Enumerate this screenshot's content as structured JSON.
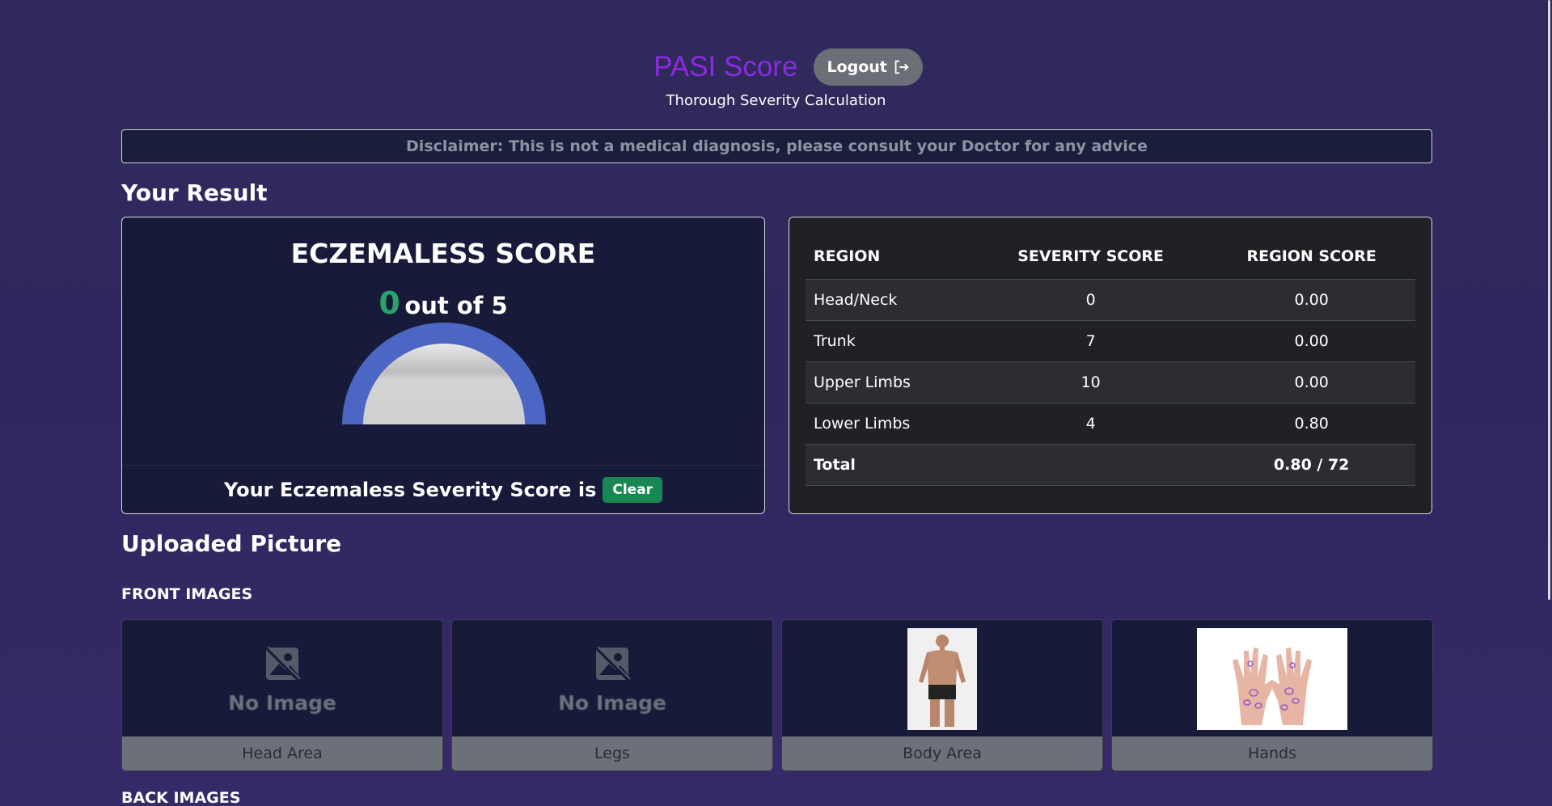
{
  "header": {
    "title": "PASI Score",
    "logout_label": "Logout",
    "subtitle": "Thorough Severity Calculation"
  },
  "disclaimer": "Disclaimer: This is not a medical diagnosis, please consult your Doctor for any advice",
  "result": {
    "heading": "Your Result",
    "score_title": "ECZEMALESS SCORE",
    "score_value": "0",
    "score_outof": "out of 5",
    "gauge_fraction": 0,
    "footer_text": "Your Eczemaless Severity Score is",
    "severity_badge": "Clear"
  },
  "table": {
    "headers": [
      "REGION",
      "SEVERITY SCORE",
      "REGION SCORE"
    ],
    "rows": [
      {
        "region": "Head/Neck",
        "severity": "0",
        "score": "0.00"
      },
      {
        "region": "Trunk",
        "severity": "7",
        "score": "0.00"
      },
      {
        "region": "Upper Limbs",
        "severity": "10",
        "score": "0.00"
      },
      {
        "region": "Lower Limbs",
        "severity": "4",
        "score": "0.80"
      }
    ],
    "total": {
      "label": "Total",
      "severity": "",
      "score": "0.80 / 72"
    }
  },
  "uploaded": {
    "heading": "Uploaded Picture",
    "front_heading": "FRONT IMAGES",
    "back_heading": "BACK IMAGES",
    "no_image_text": "No Image",
    "front": [
      {
        "label": "Head Area",
        "has_image": false
      },
      {
        "label": "Legs",
        "has_image": false
      },
      {
        "label": "Body Area",
        "has_image": true
      },
      {
        "label": "Hands",
        "has_image": true
      }
    ]
  },
  "colors": {
    "title": "#8a2be2",
    "score_green": "#29a36a",
    "badge_green": "#198754",
    "gauge_blue": "#4b66c3"
  }
}
